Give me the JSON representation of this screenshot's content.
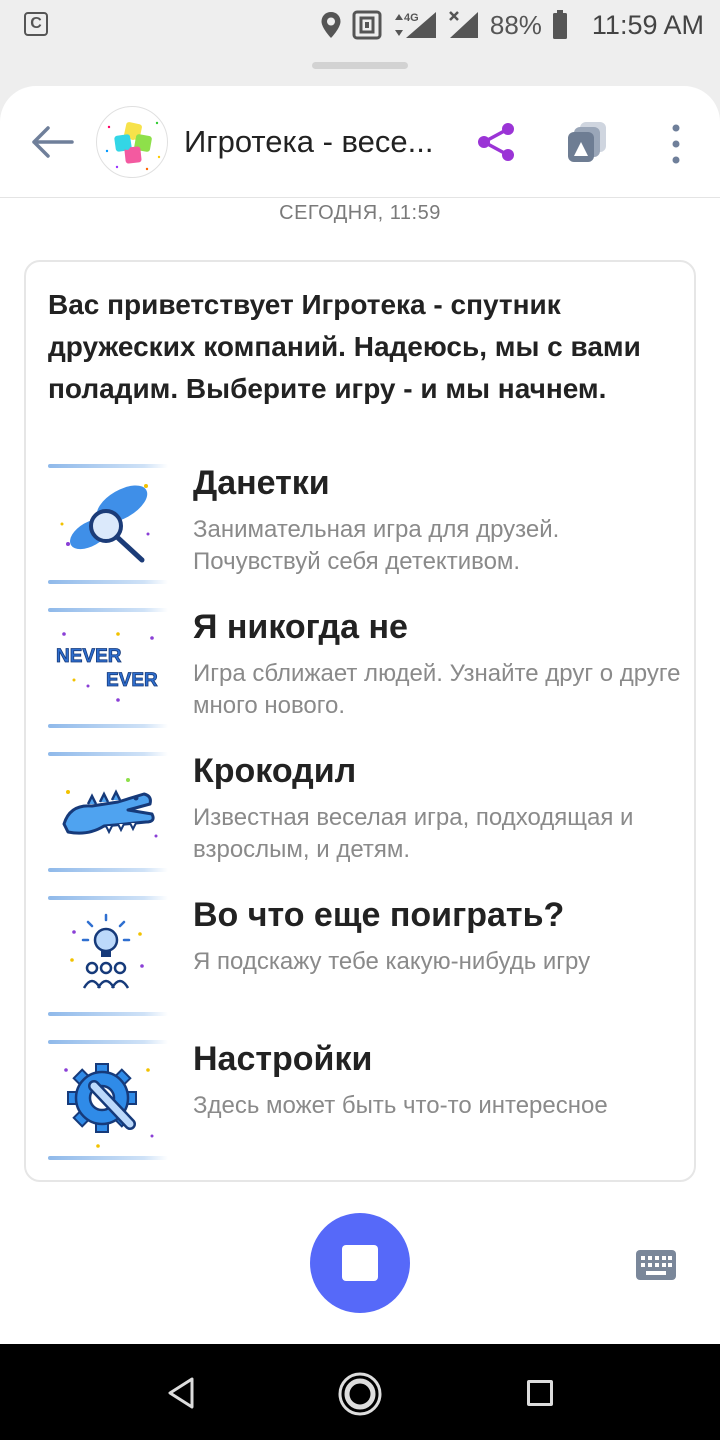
{
  "status_bar": {
    "left_icon": "C",
    "battery": "88%",
    "time": "11:59 AM",
    "icons": [
      "location-icon",
      "nfc-icon",
      "data-arrows-icon",
      "signal-4g-icon",
      "signal-x-icon",
      "battery-icon"
    ],
    "network": "4G"
  },
  "header": {
    "title": "Игротека - весе...",
    "icons": [
      "back-arrow-icon",
      "puzzle-avatar",
      "share-icon",
      "cards-icon",
      "more-vertical-icon"
    ],
    "accent_color": "#9b34d6"
  },
  "chat": {
    "date": "СЕГОДНЯ, 11:59",
    "greeting": "Вас приветствует Игротека - спутник дружеских компаний. Надеюсь, мы с вами поладим. Выберите игру - и мы начнем.",
    "items": [
      {
        "title": "Данетки",
        "desc": "Занимательная игра для друзей. Почувствуй себя детективом.",
        "icon": "footprint-magnifier-icon"
      },
      {
        "title": "Я никогда не",
        "desc": "Игра сближает людей. Узнайте друг о друге много нового.",
        "icon": "never-ever-icon",
        "icon_text_1": "NEVER",
        "icon_text_2": "EVER"
      },
      {
        "title": "Крокодил",
        "desc": "Известная веселая игра, подходящая и взрослым, и детям.",
        "icon": "crocodile-icon"
      },
      {
        "title": "Во что еще поиграть?",
        "desc": "Я подскажу тебе какую-нибудь игру",
        "icon": "lightbulb-people-icon"
      },
      {
        "title": "Настройки",
        "desc": "Здесь может быть что-то интересное",
        "icon": "gear-wrench-icon"
      }
    ]
  },
  "controls": {
    "stop_button_color": "#5669f9",
    "icons": [
      "stop-icon",
      "keyboard-icon"
    ]
  },
  "nav_bar": {
    "icons": [
      "nav-back-icon",
      "nav-home-icon",
      "nav-recent-icon"
    ]
  }
}
